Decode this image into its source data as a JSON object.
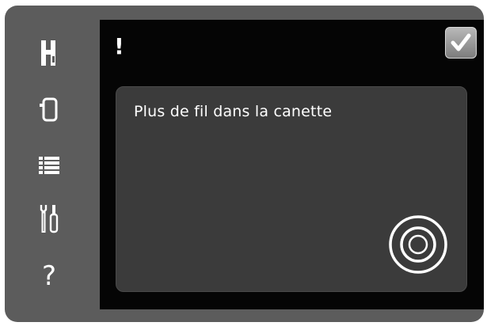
{
  "sidebar": {
    "items": [
      {
        "name": "presser-foot-icon"
      },
      {
        "name": "hoop-icon"
      },
      {
        "name": "menu-list-icon"
      },
      {
        "name": "tools-icon"
      },
      {
        "name": "help-icon",
        "glyph": "?"
      }
    ]
  },
  "screen": {
    "alert_glyph": "!",
    "message": "Plus de fil dans la canette",
    "ok_icon": "check-icon",
    "bobbin_icon": "bobbin-icon"
  },
  "colors": {
    "frame": "#5c5c5c",
    "screen": "#050505",
    "panel": "#3b3b3b",
    "text": "#ffffff"
  }
}
